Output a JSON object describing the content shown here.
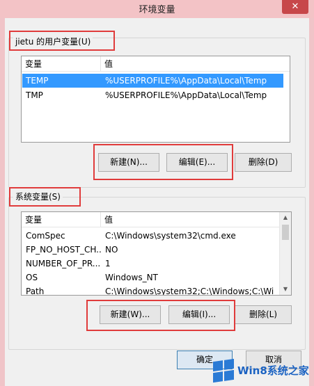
{
  "window": {
    "title": "环境变量",
    "close_glyph": "✕"
  },
  "user_vars": {
    "group_label": "jietu 的用户变量(U)",
    "columns": [
      "变量",
      "值"
    ],
    "rows": [
      {
        "name": "TEMP",
        "value": "%USERPROFILE%\\AppData\\Local\\Temp",
        "selected": true
      },
      {
        "name": "TMP",
        "value": "%USERPROFILE%\\AppData\\Local\\Temp",
        "selected": false
      }
    ],
    "new_label": "新建(N)...",
    "edit_label": "编辑(E)...",
    "delete_label": "删除(D)"
  },
  "system_vars": {
    "group_label": "系统变量(S)",
    "columns": [
      "变量",
      "值"
    ],
    "rows": [
      {
        "name": "ComSpec",
        "value": "C:\\Windows\\system32\\cmd.exe"
      },
      {
        "name": "FP_NO_HOST_CH...",
        "value": "NO"
      },
      {
        "name": "NUMBER_OF_PR...",
        "value": "1"
      },
      {
        "name": "OS",
        "value": "Windows_NT"
      },
      {
        "name": "Path",
        "value": "C:\\Windows\\system32;C:\\Windows;C:\\Wi"
      }
    ],
    "new_label": "新建(W)...",
    "edit_label": "编辑(I)...",
    "delete_label": "删除(L)"
  },
  "footer": {
    "ok_label": "确定",
    "cancel_label": "取消"
  },
  "watermark": {
    "text": "Win8系统之家"
  },
  "colors": {
    "highlight": "#e03b3b",
    "selection": "#3399ff",
    "titlebar": "#f3c3c6"
  }
}
